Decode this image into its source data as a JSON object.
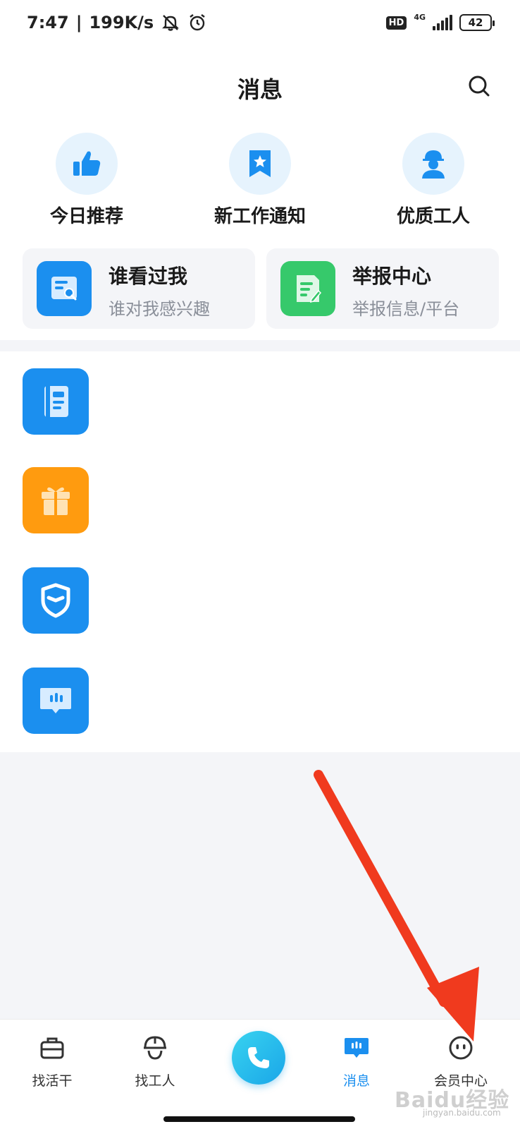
{
  "status_bar": {
    "time": "7:47",
    "speed": "199K/s",
    "hd": "HD",
    "network": "4G",
    "battery": "42"
  },
  "header": {
    "title": "消息"
  },
  "quick_entries": [
    {
      "label": "今日推荐",
      "icon": "thumbs-up-icon"
    },
    {
      "label": "新工作通知",
      "icon": "bookmark-star-icon"
    },
    {
      "label": "优质工人",
      "icon": "worker-icon"
    }
  ],
  "cards": [
    {
      "title": "谁看过我",
      "subtitle": "谁对我感兴趣",
      "icon": "profile-search-icon",
      "color": "#1b8fef"
    },
    {
      "title": "举报中心",
      "subtitle": "举报信息/平台",
      "icon": "document-edit-icon",
      "color": "#36c96b"
    }
  ],
  "list_items": [
    {
      "icon": "notebook-icon",
      "color": "#1b8fef"
    },
    {
      "icon": "gift-icon",
      "color": "#ff9b0f"
    },
    {
      "icon": "shield-icon",
      "color": "#1b8fef"
    },
    {
      "icon": "chat-bubble-icon",
      "color": "#1b8fef"
    }
  ],
  "tab_bar": {
    "tabs": [
      {
        "label": "找活干",
        "icon": "briefcase-icon",
        "active": false
      },
      {
        "label": "找工人",
        "icon": "helmet-icon",
        "active": false
      },
      {
        "label": "消息",
        "icon": "message-icon",
        "active": true
      },
      {
        "label": "会员中心",
        "icon": "smiley-icon",
        "active": false
      }
    ],
    "call_icon": "phone-icon"
  },
  "watermark": {
    "text": "Baidu经验",
    "url": "jingyan.baidu.com"
  },
  "colors": {
    "accent": "#1b8fef",
    "annotation_arrow": "#f03a1e"
  }
}
